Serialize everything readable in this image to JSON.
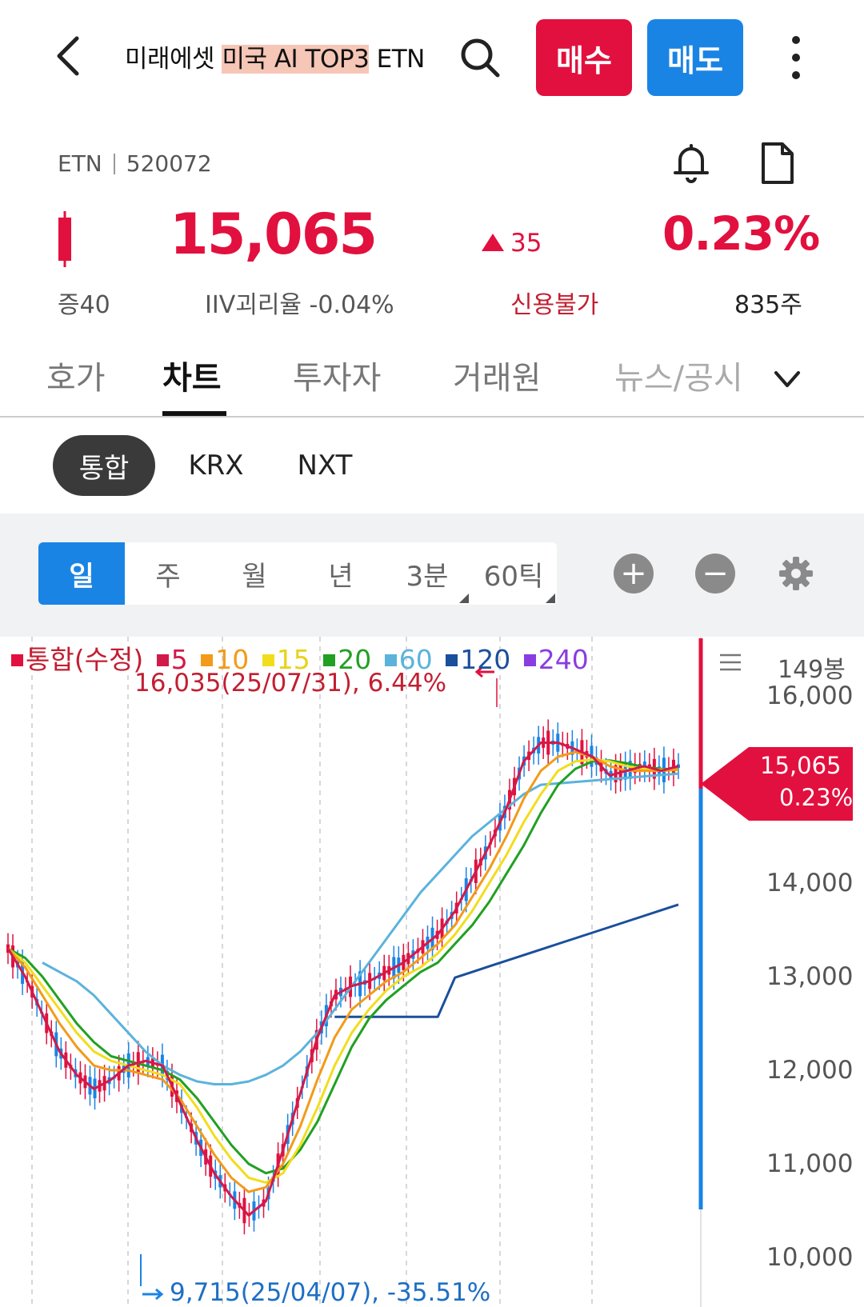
{
  "header": {
    "title_prefix": "미래에셋 ",
    "title_highlight": "미국 AI TOP3",
    "title_suffix": " ETN",
    "buy_label": "매수",
    "sell_label": "매도"
  },
  "info": {
    "type": "ETN",
    "code": "520072",
    "price": "15,065",
    "change": "35",
    "change_pct": "0.23%",
    "margin": "증40",
    "iiv_gap": "IIV괴리율 -0.04%",
    "credit": "신용불가",
    "volume": "835주",
    "accent_up": "#e2103e",
    "accent_blue": "#1a84e5"
  },
  "tabs": [
    "호가",
    "차트",
    "투자자",
    "거래원",
    "뉴스/공시"
  ],
  "active_tab": "차트",
  "segments": [
    "통합",
    "KRX",
    "NXT"
  ],
  "periods": [
    "일",
    "주",
    "월",
    "년",
    "3분",
    "60틱"
  ],
  "chart_data": {
    "type": "line",
    "legend": [
      {
        "name": "통합(수정)",
        "color": "#e2103e"
      },
      {
        "name": "5",
        "color": "#d21a4a"
      },
      {
        "name": "10",
        "color": "#f39a1a"
      },
      {
        "name": "15",
        "color": "#f2dd1c"
      },
      {
        "name": "20",
        "color": "#22a022"
      },
      {
        "name": "60",
        "color": "#5bb3dc"
      },
      {
        "name": "120",
        "color": "#1a4f9c"
      },
      {
        "name": "240",
        "color": "#8a3ce0"
      }
    ],
    "bar_count": "149봉",
    "y_ticks": [
      "16,000",
      "14,000",
      "13,000",
      "12,000",
      "11,000",
      "10,000"
    ],
    "ylim": [
      9700,
      16300
    ],
    "high_annotation": "16,035(25/07/31), 6.44%",
    "low_annotation": "9,715(25/04/07), -35.51%",
    "current_price": "15,065",
    "current_pct": "0.23%",
    "ma5": [
      13300,
      13000,
      12600,
      12200,
      11950,
      11800,
      11900,
      12050,
      12100,
      12050,
      11650,
      11250,
      10900,
      10650,
      10450,
      10600,
      11150,
      11750,
      12350,
      12800,
      12900,
      12950,
      13050,
      13150,
      13300,
      13450,
      13700,
      14050,
      14400,
      14800,
      15300,
      15500,
      15500,
      15430,
      15350,
      15150,
      15200,
      15250,
      15200,
      15250
    ],
    "ma10": [
      13300,
      13100,
      12800,
      12500,
      12250,
      12050,
      12000,
      12000,
      11950,
      11900,
      11700,
      11400,
      11100,
      10850,
      10700,
      10750,
      11000,
      11400,
      11900,
      12350,
      12650,
      12800,
      12950,
      13050,
      13200,
      13350,
      13550,
      13850,
      14150,
      14500,
      14900,
      15200,
      15350,
      15400,
      15350,
      15250,
      15200,
      15200,
      15200,
      15210
    ],
    "ma15": [
      13300,
      13150,
      12900,
      12650,
      12400,
      12200,
      12100,
      12050,
      12000,
      11950,
      11850,
      11600,
      11300,
      11050,
      10850,
      10800,
      10900,
      11200,
      11600,
      12050,
      12400,
      12650,
      12850,
      13000,
      13100,
      13250,
      13450,
      13700,
      14000,
      14300,
      14650,
      14950,
      15200,
      15300,
      15320,
      15300,
      15250,
      15220,
      15210,
      15210
    ],
    "ma20": [
      13300,
      13200,
      13000,
      12750,
      12500,
      12300,
      12150,
      12100,
      12050,
      12000,
      11900,
      11700,
      11450,
      11200,
      11000,
      10900,
      10950,
      11150,
      11450,
      11850,
      12250,
      12550,
      12750,
      12900,
      13050,
      13150,
      13350,
      13550,
      13800,
      14100,
      14400,
      14750,
      15050,
      15220,
      15300,
      15310,
      15280,
      15240,
      15220,
      15215
    ],
    "ma60": [
      null,
      null,
      13150,
      13050,
      12950,
      12800,
      12600,
      12400,
      12200,
      12050,
      11950,
      11880,
      11850,
      11850,
      11880,
      11950,
      12050,
      12200,
      12400,
      12650,
      12900,
      13150,
      13400,
      13650,
      13900,
      14100,
      14300,
      14500,
      14650,
      14800,
      14950,
      15050
    ]
  }
}
